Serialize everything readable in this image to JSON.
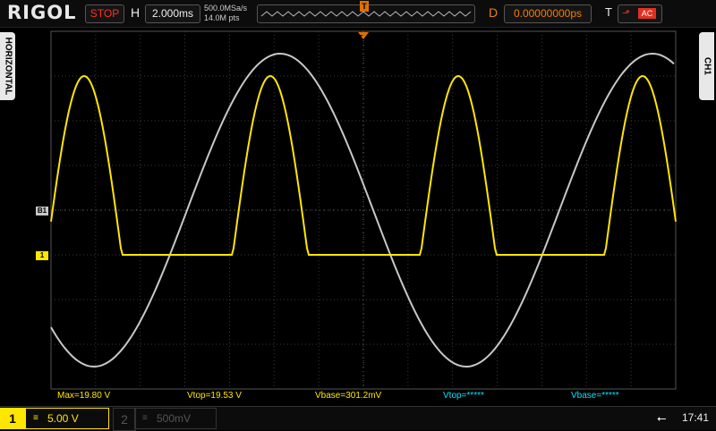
{
  "header": {
    "brand": "RIGOL",
    "run_state": "STOP",
    "horizontal_label": "H",
    "timebase": "2.000ms",
    "sample_rate": "500.0MSa/s",
    "memory_depth": "14.0M pts",
    "trigger_position_marker": "T",
    "delay_label": "D",
    "delay_value": "0.00000000ps",
    "trigger_label": "T",
    "trigger_coupling": "AC"
  },
  "side_tabs": {
    "left": "HORIZONTAL",
    "right": "CH1"
  },
  "markers": {
    "ch1_level": "1",
    "b1_level": "B1",
    "trigger_top": "T"
  },
  "measurements": [
    {
      "text": "Max=19.80 V",
      "color": "#ffe600"
    },
    {
      "text": "Vtop=19.53 V",
      "color": "#ffe600"
    },
    {
      "text": "Vbase=301.2mV",
      "color": "#ffe600"
    },
    {
      "text": "Vtop=*****",
      "color": "#00e5ff"
    },
    {
      "text": "Vbase=*****",
      "color": "#00e5ff"
    }
  ],
  "channels": {
    "ch1": {
      "number": "1",
      "coupling": "≡",
      "scale": "5.00 V",
      "color": "#ffe600"
    },
    "ch2": {
      "number": "2",
      "coupling": "≡",
      "scale": "500mV",
      "color": "#555555"
    }
  },
  "status": {
    "usb_icon": "usb-icon",
    "time": "17:41"
  },
  "colors": {
    "ch1": "#ffe600",
    "reference": "#c8c8c8",
    "grid": "#444444"
  }
}
